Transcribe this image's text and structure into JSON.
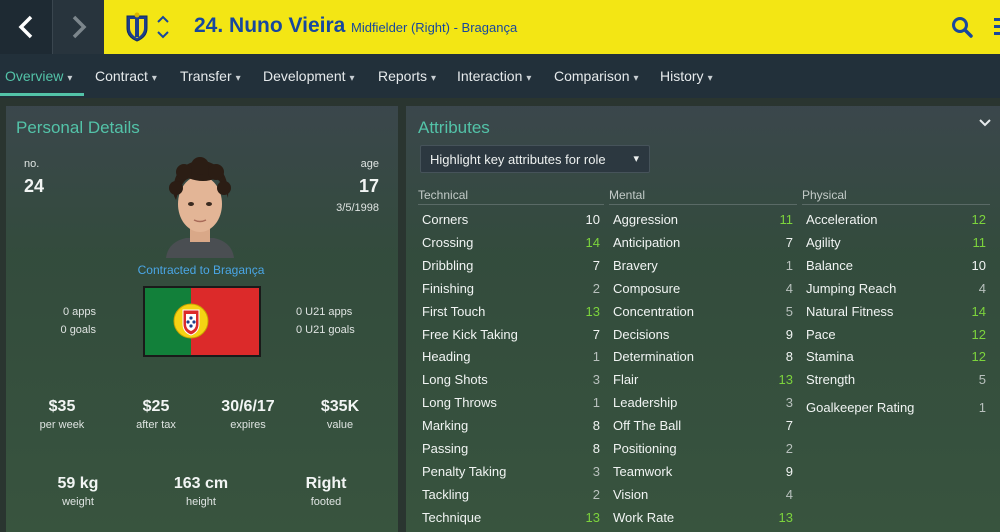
{
  "header": {
    "player_title": "24. Nuno Vieira",
    "player_subtitle": "Midfielder (Right) - Bragança",
    "icons": [
      "back-arrow-icon",
      "forward-arrow-icon",
      "club-badge-icon",
      "up-down-chevron-icon",
      "search-icon"
    ]
  },
  "tabs": [
    {
      "label": "Overview"
    },
    {
      "label": "Contract"
    },
    {
      "label": "Transfer"
    },
    {
      "label": "Development"
    },
    {
      "label": "Reports"
    },
    {
      "label": "Interaction"
    },
    {
      "label": "Comparison"
    },
    {
      "label": "History"
    }
  ],
  "personal": {
    "title": "Personal Details",
    "no_label": "no.",
    "no_value": "24",
    "age_label": "age",
    "age_value": "17",
    "dob": "3/5/1998",
    "contracted": "Contracted to Bragança",
    "apps": "0 apps",
    "goals": "0 goals",
    "u21_apps": "0 U21 apps",
    "u21_goals": "0 U21 goals",
    "wage": "$35",
    "wage_label": "per week",
    "after_tax": "$25",
    "after_tax_label": "after tax",
    "expires": "30/6/17",
    "expires_label": "expires",
    "value": "$35K",
    "value_label": "value",
    "weight": "59 kg",
    "weight_label": "weight",
    "height": "163 cm",
    "height_label": "height",
    "footed": "Right",
    "footed_label": "footed",
    "nationality_flag": "portugal-flag-icon"
  },
  "attributes": {
    "title": "Attributes",
    "highlight_dropdown": "Highlight key attributes for role",
    "technical_header": "Technical",
    "mental_header": "Mental",
    "physical_header": "Physical",
    "technical": [
      {
        "name": "Corners",
        "value": "10"
      },
      {
        "name": "Crossing",
        "value": "14"
      },
      {
        "name": "Dribbling",
        "value": "7"
      },
      {
        "name": "Finishing",
        "value": "2"
      },
      {
        "name": "First Touch",
        "value": "13"
      },
      {
        "name": "Free Kick Taking",
        "value": "7"
      },
      {
        "name": "Heading",
        "value": "1"
      },
      {
        "name": "Long Shots",
        "value": "3"
      },
      {
        "name": "Long Throws",
        "value": "1"
      },
      {
        "name": "Marking",
        "value": "8"
      },
      {
        "name": "Passing",
        "value": "8"
      },
      {
        "name": "Penalty Taking",
        "value": "3"
      },
      {
        "name": "Tackling",
        "value": "2"
      },
      {
        "name": "Technique",
        "value": "13"
      }
    ],
    "mental": [
      {
        "name": "Aggression",
        "value": "11"
      },
      {
        "name": "Anticipation",
        "value": "7"
      },
      {
        "name": "Bravery",
        "value": "1"
      },
      {
        "name": "Composure",
        "value": "4"
      },
      {
        "name": "Concentration",
        "value": "5"
      },
      {
        "name": "Decisions",
        "value": "9"
      },
      {
        "name": "Determination",
        "value": "8"
      },
      {
        "name": "Flair",
        "value": "13"
      },
      {
        "name": "Leadership",
        "value": "3"
      },
      {
        "name": "Off The Ball",
        "value": "7"
      },
      {
        "name": "Positioning",
        "value": "2"
      },
      {
        "name": "Teamwork",
        "value": "9"
      },
      {
        "name": "Vision",
        "value": "4"
      },
      {
        "name": "Work Rate",
        "value": "13"
      }
    ],
    "physical": [
      {
        "name": "Acceleration",
        "value": "12"
      },
      {
        "name": "Agility",
        "value": "11"
      },
      {
        "name": "Balance",
        "value": "10"
      },
      {
        "name": "Jumping Reach",
        "value": "4"
      },
      {
        "name": "Natural Fitness",
        "value": "14"
      },
      {
        "name": "Pace",
        "value": "12"
      },
      {
        "name": "Stamina",
        "value": "12"
      },
      {
        "name": "Strength",
        "value": "5"
      }
    ],
    "goalkeeper": {
      "name": "Goalkeeper Rating",
      "value": "1"
    }
  },
  "colors": {
    "header_bg": "#f3e614",
    "accent": "#53c3a8",
    "high_value": "#7cd33c",
    "low_value": "#b8c0bd",
    "link": "#4aa6e6"
  }
}
